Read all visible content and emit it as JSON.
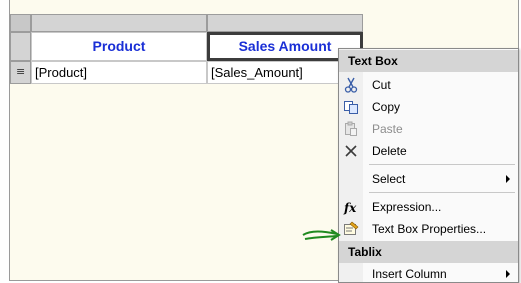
{
  "tablix": {
    "header": {
      "col1": "Product",
      "col2": "Sales Amount"
    },
    "detail": {
      "col1": "[Product]",
      "col2": "[Sales_Amount]"
    },
    "row_handle_icon": "row-group-icon"
  },
  "context_menu": {
    "sections": [
      {
        "title": "Text Box",
        "items": [
          {
            "label": "Cut",
            "icon": "scissors-icon",
            "enabled": true
          },
          {
            "label": "Copy",
            "icon": "copy-icon",
            "enabled": true
          },
          {
            "label": "Paste",
            "icon": "paste-icon",
            "enabled": false
          },
          {
            "label": "Delete",
            "icon": "delete-x-icon",
            "enabled": true
          },
          {
            "label": "Select",
            "submenu": true,
            "enabled": true
          },
          {
            "label": "Expression...",
            "icon": "fx-icon",
            "enabled": true
          },
          {
            "label": "Text Box Properties...",
            "icon": "properties-icon",
            "enabled": true
          }
        ]
      },
      {
        "title": "Tablix",
        "items": [
          {
            "label": "Insert Column",
            "submenu": true,
            "enabled": true
          }
        ]
      }
    ]
  },
  "colors": {
    "header_text": "#1a2fd6",
    "annotation_arrow": "#1f8a1f",
    "menu_header_bg": "#d5d5d5",
    "surface_bg": "#fdfbee"
  }
}
